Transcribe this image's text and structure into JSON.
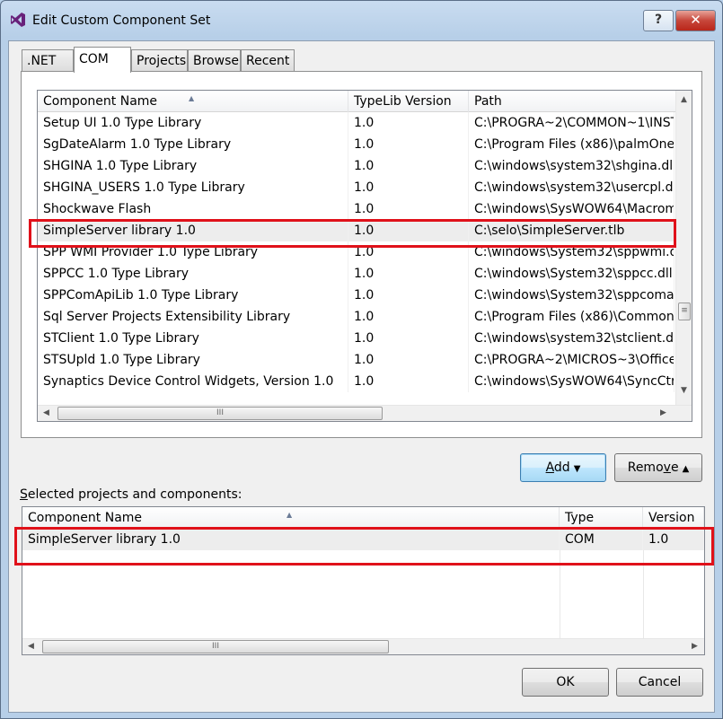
{
  "window": {
    "title": "Edit Custom Component Set",
    "help_glyph": "?",
    "close_glyph": "✕"
  },
  "tabs": [
    {
      "label": ".NET"
    },
    {
      "label": "COM"
    },
    {
      "label": "Projects"
    },
    {
      "label": "Browse"
    },
    {
      "label": "Recent"
    }
  ],
  "active_tab": "COM",
  "components": {
    "columns": [
      "Component Name",
      "TypeLib Version",
      "Path"
    ],
    "rows": [
      {
        "name": "Setup UI 1.0 Type Library",
        "version": "1.0",
        "path": "C:\\PROGRA~2\\COMMON~1\\INST"
      },
      {
        "name": "SgDateAlarm 1.0 Type Library",
        "version": "1.0",
        "path": "C:\\Program Files (x86)\\palmOne\\"
      },
      {
        "name": "SHGINA 1.0 Type Library",
        "version": "1.0",
        "path": "C:\\windows\\system32\\shgina.dll"
      },
      {
        "name": "SHGINA_USERS 1.0 Type Library",
        "version": "1.0",
        "path": "C:\\windows\\system32\\usercpl.dll"
      },
      {
        "name": "Shockwave Flash",
        "version": "1.0",
        "path": "C:\\windows\\SysWOW64\\Macrom"
      },
      {
        "name": "SimpleServer library 1.0",
        "version": "1.0",
        "path": "C:\\selo\\SimpleServer.tlb"
      },
      {
        "name": "SPP WMI Provider 1.0 Type Library",
        "version": "1.0",
        "path": "C:\\windows\\System32\\sppwmi.dl"
      },
      {
        "name": "SPPCC 1.0 Type Library",
        "version": "1.0",
        "path": "C:\\windows\\System32\\sppcc.dll"
      },
      {
        "name": "SPPComApiLib 1.0 Type Library",
        "version": "1.0",
        "path": "C:\\windows\\System32\\sppcomap"
      },
      {
        "name": "Sql Server Projects Extensibility Library",
        "version": "1.0",
        "path": "C:\\Program Files (x86)\\Common"
      },
      {
        "name": "STClient 1.0 Type Library",
        "version": "1.0",
        "path": "C:\\windows\\system32\\stclient.dll"
      },
      {
        "name": "STSUpld 1.0 Type Library",
        "version": "1.0",
        "path": "C:\\PROGRA~2\\MICROS~3\\Office"
      },
      {
        "name": "Synaptics Device Control Widgets, Version 1.0",
        "version": "1.0",
        "path": "C:\\windows\\SysWOW64\\SyncCtrl.c"
      }
    ],
    "selected_index": 5
  },
  "buttons": {
    "add": {
      "label": "Add",
      "accel": "A",
      "rest": "dd"
    },
    "remove": {
      "label": "Remove",
      "pre": "Remo",
      "accel": "v",
      "post": "e"
    },
    "ok": "OK",
    "cancel": "Cancel"
  },
  "selected_section": {
    "label_accel": "S",
    "label_rest": "elected projects and components:",
    "columns": [
      "Component Name",
      "Type",
      "Version"
    ],
    "rows": [
      {
        "name": "SimpleServer library 1.0",
        "type": "COM",
        "version": "1.0"
      }
    ]
  },
  "scroll": {
    "vthumb_glyph": "≡",
    "hthumb_glyph": "III",
    "up": "▲",
    "down": "▼",
    "left": "◀",
    "right": "▶"
  },
  "colors": {
    "highlight": "#e0111a",
    "selected_row": "#ededed",
    "vs_purple": "#68217a"
  }
}
